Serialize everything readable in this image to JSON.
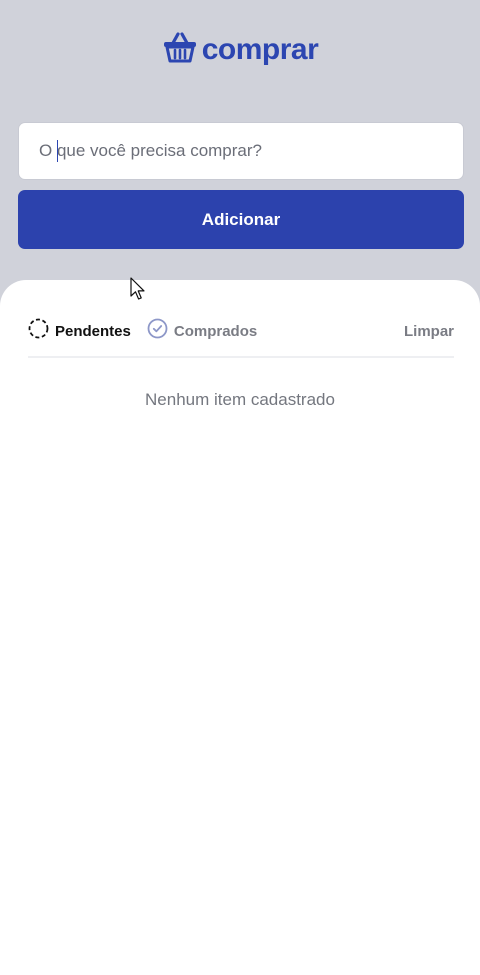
{
  "header": {
    "logo_text": "comprar",
    "logo_icon": "basket-icon",
    "brand_color": "#2c46b1"
  },
  "form": {
    "item_placeholder": "O que você precisa comprar?",
    "item_value": "",
    "add_button_label": "Adicionar"
  },
  "filters": {
    "tabs": [
      {
        "label": "Pendentes",
        "icon": "dashed-circle-icon",
        "active": true
      },
      {
        "label": "Comprados",
        "icon": "check-circle-icon",
        "active": false
      }
    ],
    "clear_label": "Limpar"
  },
  "list": {
    "items": [],
    "empty_message": "Nenhum item cadastrado"
  }
}
